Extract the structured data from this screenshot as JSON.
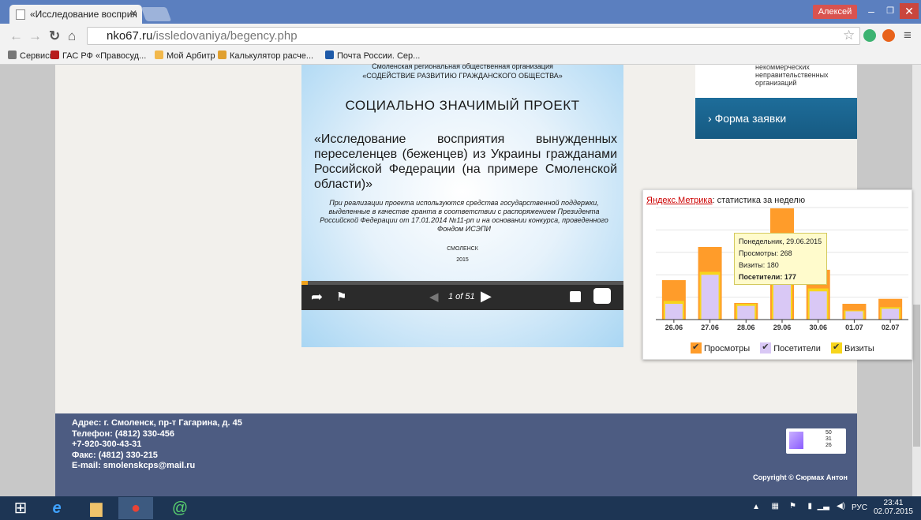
{
  "browser": {
    "tab_title": "«Исследование восприя",
    "user_name": "Алексей",
    "url_host": "nko67.ru",
    "url_path": "/issledovaniya/begency.php",
    "bookmarks": [
      {
        "label": "Сервисы",
        "color": "#e5e5e5"
      },
      {
        "label": "ГАС РФ «Правосуд...",
        "color": "#b71c1c"
      },
      {
        "label": "Мой Арбитр",
        "color": "#f2b84b"
      },
      {
        "label": "Калькулятор расче...",
        "color": "#e0a030"
      },
      {
        "label": "Почта России. Сер...",
        "color": "#1e5aa8"
      }
    ]
  },
  "slide": {
    "org_line1": "Смоленская региональная общественная организация",
    "org_line2": "«СОДЕЙСТВИЕ РАЗВИТИЮ ГРАЖДАНСКОГО ОБЩЕСТВА»",
    "heading": "СОЦИАЛЬНО ЗНАЧИМЫЙ ПРОЕКТ",
    "project_title": "«Исследование восприятия вынужденных переселенцев (беженцев) из Украины гражданами Российской Федерации (на примере Смоленской области)»",
    "note": "При реализации проекта используются средства государственной поддержки, выделенные в качестве гранта в соответствии с распоряжением Президента Российской Федерации от 17.01.2014 №11-рп и на основании конкурса, проведенного Фондом ИСЭПИ",
    "city": "СМОЛЕНСК",
    "year": "2015",
    "page_indicator": "1 of 51",
    "progress": 0.02
  },
  "sidebar": {
    "text": "некоммерческих неправительственных организаций",
    "form_link": "Форма заявки"
  },
  "footer": {
    "address": "Адрес: г. Смоленск, пр-т Гагарина, д. 45",
    "phone1": "Телефон: (4812) 330-456",
    "phone2": "+7-920-300-43-31",
    "fax": "Факс: (4812) 330-215",
    "email": "E-mail: smolenskcps@mail.ru",
    "copyright": "Copyright © Сюрмах Антон",
    "counter": [
      "50",
      "31",
      "26"
    ]
  },
  "metrika": {
    "brand": "Яндекс.Метрика",
    "caption": ": статистика за неделю",
    "tooltip": {
      "date": "Понедельник, 29.06.2015",
      "views": "Просмотры: 268",
      "visits": "Визиты: 180",
      "visitors_label": "Посетители:",
      "visitors_value": "177"
    },
    "legend": [
      {
        "label": "Просмотры",
        "color": "#ff9c2a"
      },
      {
        "label": "Посетители",
        "color": "#d9c8f5"
      },
      {
        "label": "Визиты",
        "color": "#f7d51c"
      }
    ]
  },
  "chart_data": {
    "type": "bar",
    "categories": [
      "26.06",
      "27.06",
      "28.06",
      "29.06",
      "30.06",
      "01.07",
      "02.07"
    ],
    "series": [
      {
        "name": "Просмотры",
        "color": "#ff9c2a",
        "values": [
          95,
          175,
          40,
          268,
          120,
          38,
          50
        ]
      },
      {
        "name": "Визиты",
        "color": "#f7d51c",
        "values": [
          45,
          115,
          38,
          180,
          75,
          22,
          30
        ]
      },
      {
        "name": "Посетители",
        "color": "#d9c8f5",
        "values": [
          38,
          108,
          33,
          177,
          68,
          20,
          26
        ]
      }
    ],
    "ylim": [
      0,
      270
    ],
    "grid": true
  },
  "taskbar": {
    "lang": "РУС",
    "time": "23:41",
    "date": "02.07.2015"
  }
}
